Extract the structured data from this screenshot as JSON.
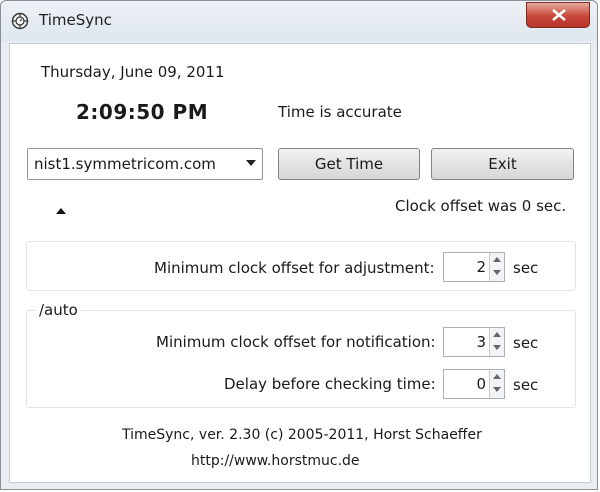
{
  "window": {
    "title": "TimeSync",
    "app_icon": "clock-gear-icon",
    "close_icon": "close-icon"
  },
  "clock": {
    "date": "Thursday, June 09, 2011",
    "time": "2:09:50 PM",
    "status": "Time is accurate"
  },
  "controls": {
    "server_selected": "nist1.symmetricom.com",
    "get_time_label": "Get Time",
    "exit_label": "Exit"
  },
  "offset_text": "Clock offset was  0 sec.",
  "settings": {
    "adjust_label": "Minimum clock offset for adjustment:",
    "adjust_value": "2",
    "group_label": "/auto",
    "notify_label": "Minimum clock offset for notification:",
    "notify_value": "3",
    "delay_label": "Delay before checking time:",
    "delay_value": "0",
    "unit": "sec"
  },
  "footer": {
    "line1": "TimeSync, ver. 2.30  (c) 2005-2011, Horst Schaeffer",
    "line2": "http://www.horstmuc.de"
  },
  "colors": {
    "titlebar": "#dfe6ee",
    "close_button": "#c8483a",
    "client_bg": "#ffffff"
  }
}
